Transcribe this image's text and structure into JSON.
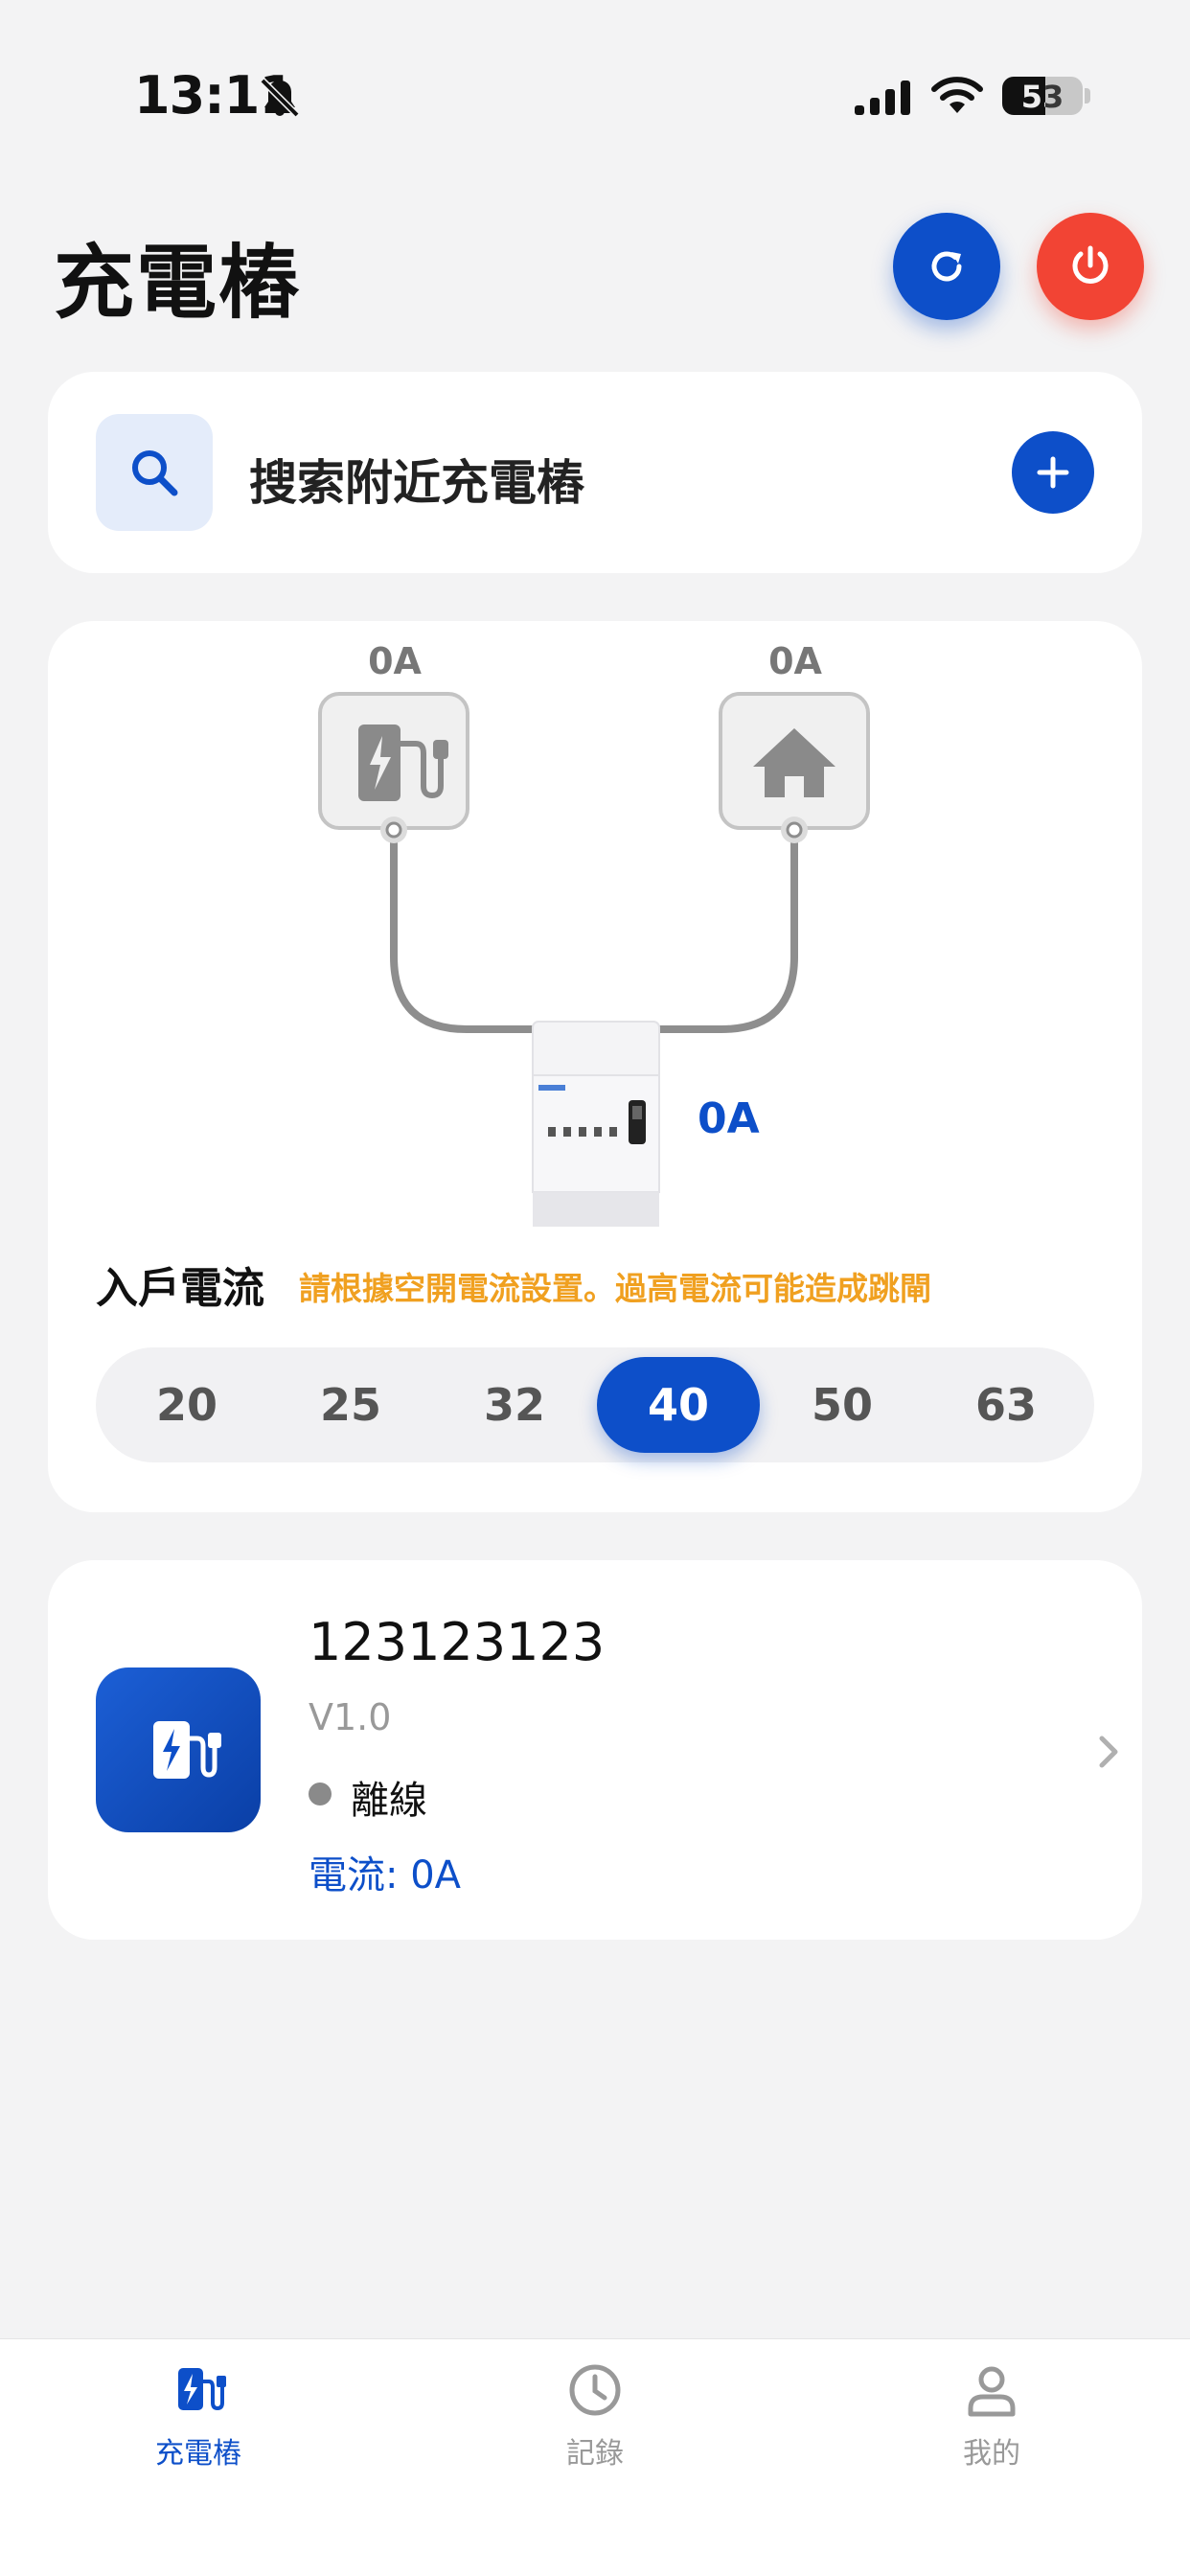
{
  "status_bar": {
    "time": "13:11",
    "battery": "53"
  },
  "header": {
    "title": "充電樁"
  },
  "search": {
    "label": "搜索附近充電樁"
  },
  "diagram": {
    "charger_amp": "0A",
    "home_amp": "0A",
    "meter_amp": "0A",
    "household_label": "入戶電流",
    "warning": "請根據空開電流設置。過高電流可能造成跳閘",
    "current_options": [
      "20",
      "25",
      "32",
      "40",
      "50",
      "63"
    ],
    "selected_current": "40"
  },
  "charger": {
    "name": "123123123",
    "version": "V1.0",
    "status": "離線",
    "current": "電流: 0A"
  },
  "tabs": [
    {
      "label": "充電樁",
      "active": true
    },
    {
      "label": "記錄",
      "active": false
    },
    {
      "label": "我的",
      "active": false
    }
  ],
  "colors": {
    "primary": "#0d4fc9",
    "danger": "#f24434",
    "warning": "#f0a020",
    "background": "#f3f3f4"
  }
}
